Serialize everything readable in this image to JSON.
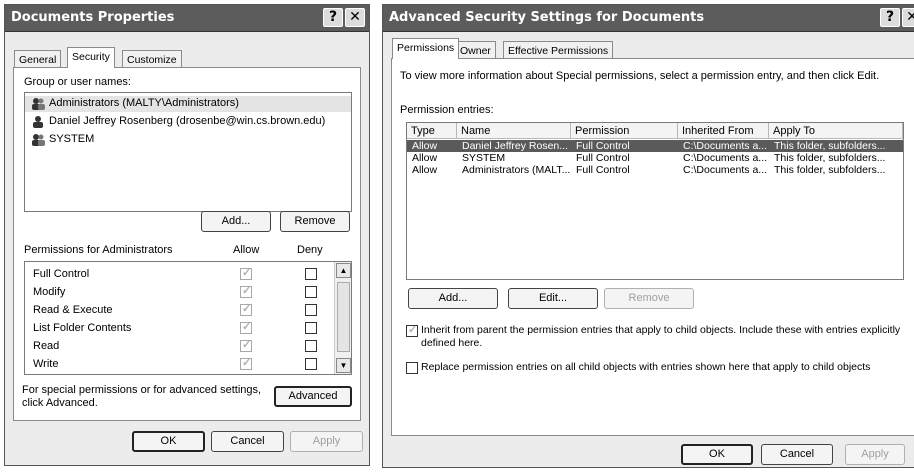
{
  "left_window": {
    "title": "Documents Properties",
    "title_help": "?",
    "title_close": "✕",
    "tabs": [
      "General",
      "Security",
      "Customize"
    ],
    "group_label": "Group or user names:",
    "users": [
      "Administrators (MALTY\\Administrators)",
      "Daniel Jeffrey Rosenberg (drosenbe@win.cs.brown.edu)",
      "SYSTEM"
    ],
    "add_button": "Add...",
    "remove_button": "Remove",
    "permissions_label": "Permissions for Administrators",
    "allow_header": "Allow",
    "deny_header": "Deny",
    "permissions": [
      {
        "name": "Full Control",
        "allow": true,
        "deny": false
      },
      {
        "name": "Modify",
        "allow": true,
        "deny": false
      },
      {
        "name": "Read & Execute",
        "allow": true,
        "deny": false
      },
      {
        "name": "List Folder Contents",
        "allow": true,
        "deny": false
      },
      {
        "name": "Read",
        "allow": true,
        "deny": false
      },
      {
        "name": "Write",
        "allow": true,
        "deny": false
      }
    ],
    "special_text_1": "For special permissions or for advanced settings,",
    "special_text_2": "click Advanced.",
    "advanced_button": "Advanced",
    "ok_button": "OK",
    "cancel_button": "Cancel",
    "apply_button": "Apply"
  },
  "right_window": {
    "title": "Advanced Security Settings for Documents",
    "title_help": "?",
    "title_close": "✕",
    "tabs": [
      "Permissions",
      "Owner",
      "Effective Permissions"
    ],
    "info_text": "To view more information about Special permissions, select a permission entry, and then click Edit.",
    "entries_label": "Permission entries:",
    "columns": [
      "Type",
      "Name",
      "Permission",
      "Inherited From",
      "Apply To"
    ],
    "rows": [
      [
        "Allow",
        "Daniel Jeffrey Rosen...",
        "Full Control",
        "C:\\Documents a...",
        "This folder, subfolders..."
      ],
      [
        "Allow",
        "SYSTEM",
        "Full Control",
        "C:\\Documents a...",
        "This folder, subfolders..."
      ],
      [
        "Allow",
        "Administrators (MALT...",
        "Full Control",
        "C:\\Documents a...",
        "This folder, subfolders..."
      ]
    ],
    "add_button": "Add...",
    "edit_button": "Edit...",
    "remove_button": "Remove",
    "inherit_text_1": "Inherit from parent the permission entries that apply to child objects. Include these with entries explicitly",
    "inherit_text_2": "defined here.",
    "inherit_checked": true,
    "replace_text": "Replace permission entries on all child objects with entries shown here that apply to child objects",
    "replace_checked": false,
    "ok_button": "OK",
    "cancel_button": "Cancel",
    "apply_button": "Apply"
  }
}
